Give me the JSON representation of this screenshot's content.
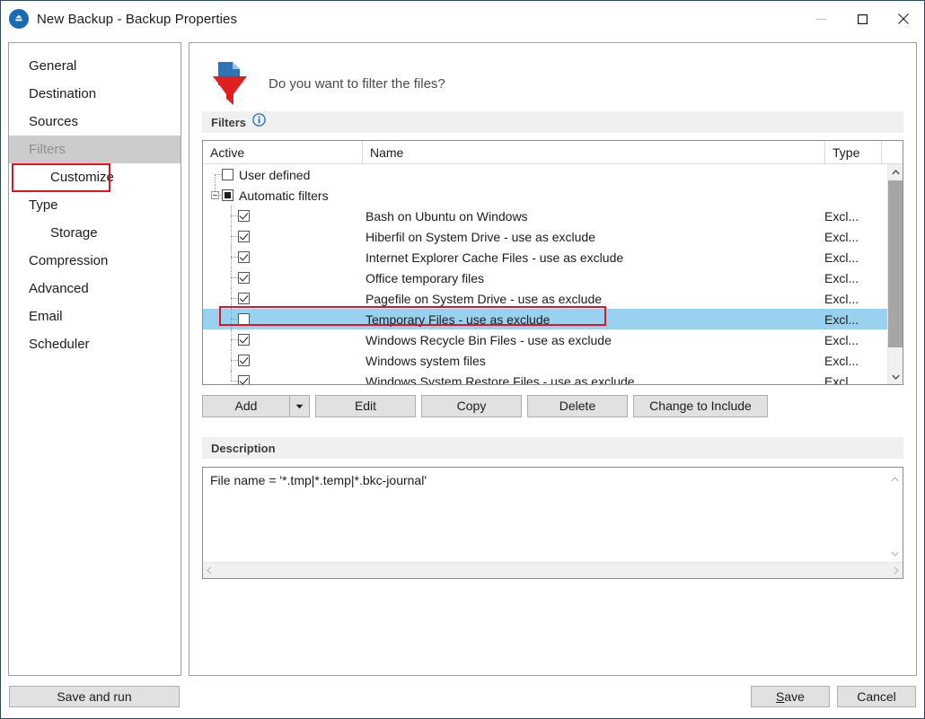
{
  "window": {
    "title": "New Backup - Backup Properties",
    "app_icon": "backup-circle-icon",
    "controls": {
      "minimize": "minimize-icon",
      "maximize": "maximize-icon",
      "close": "close-icon"
    }
  },
  "sidebar": {
    "items": [
      {
        "label": "General",
        "sub": false,
        "selected": false
      },
      {
        "label": "Destination",
        "sub": false,
        "selected": false
      },
      {
        "label": "Sources",
        "sub": false,
        "selected": false
      },
      {
        "label": "Filters",
        "sub": false,
        "selected": true
      },
      {
        "label": "Customize",
        "sub": true,
        "selected": false
      },
      {
        "label": "Type",
        "sub": false,
        "selected": false
      },
      {
        "label": "Storage",
        "sub": true,
        "selected": false
      },
      {
        "label": "Compression",
        "sub": false,
        "selected": false
      },
      {
        "label": "Advanced",
        "sub": false,
        "selected": false
      },
      {
        "label": "Email",
        "sub": false,
        "selected": false
      },
      {
        "label": "Scheduler",
        "sub": false,
        "selected": false
      }
    ]
  },
  "main": {
    "header_question": "Do you want to filter the files?",
    "header_icon": "filter-funnel-document-icon",
    "filters_group": {
      "label": "Filters",
      "info_icon": "info-circle-icon"
    },
    "list": {
      "columns": [
        "Active",
        "Name",
        "Type"
      ],
      "rows": [
        {
          "name": "User defined",
          "type": "",
          "check": "unchecked",
          "level": 0,
          "selected": false,
          "expander": false
        },
        {
          "name": "Automatic filters",
          "type": "",
          "check": "indeterminate",
          "level": 0,
          "selected": false,
          "expander": true
        },
        {
          "name": "Bash on Ubuntu on Windows",
          "type": "Excl...",
          "check": "checked",
          "level": 1,
          "selected": false,
          "expander": false
        },
        {
          "name": "Hiberfil on System Drive - use as exclude",
          "type": "Excl...",
          "check": "checked",
          "level": 1,
          "selected": false,
          "expander": false
        },
        {
          "name": "Internet Explorer Cache Files - use as exclude",
          "type": "Excl...",
          "check": "checked",
          "level": 1,
          "selected": false,
          "expander": false
        },
        {
          "name": "Office temporary files",
          "type": "Excl...",
          "check": "checked",
          "level": 1,
          "selected": false,
          "expander": false
        },
        {
          "name": "Pagefile on System Drive - use as exclude",
          "type": "Excl...",
          "check": "checked",
          "level": 1,
          "selected": false,
          "expander": false
        },
        {
          "name": "Temporary Files - use as exclude",
          "type": "Excl...",
          "check": "unchecked",
          "level": 1,
          "selected": true,
          "expander": false
        },
        {
          "name": "Windows Recycle Bin Files - use as exclude",
          "type": "Excl...",
          "check": "checked",
          "level": 1,
          "selected": false,
          "expander": false
        },
        {
          "name": "Windows system files",
          "type": "Excl...",
          "check": "checked",
          "level": 1,
          "selected": false,
          "expander": false
        },
        {
          "name": "Windows System Restore Files - use as exclude",
          "type": "Excl...",
          "check": "checked",
          "level": 1,
          "selected": false,
          "expander": false
        }
      ]
    },
    "buttons": {
      "add": "Add",
      "add_dropdown_icon": "chevron-down-icon",
      "edit": "Edit",
      "copy": "Copy",
      "delete": "Delete",
      "change_to_include": "Change to Include"
    },
    "description_group": {
      "label": "Description",
      "text": "File name = '*.tmp|*.temp|*.bkc-journal'"
    }
  },
  "footer": {
    "save_and_run": "Save and run",
    "save": "Save",
    "save_accel": "S",
    "save_rest": "ave",
    "cancel": "Cancel"
  },
  "annotations": {
    "accent_color": "#e81123",
    "boxes": [
      "sidebar-filters",
      "list-row-temporary-files"
    ]
  },
  "colors": {
    "title_accent": "#2b4865",
    "selection_blue": "#99d1f0",
    "sidebar_selected": "#cccccc",
    "group_bar": "#f0f0f0",
    "button_face": "#e1e1e1",
    "icon_blue": "#1a6bb5",
    "icon_red": "#e02020"
  }
}
